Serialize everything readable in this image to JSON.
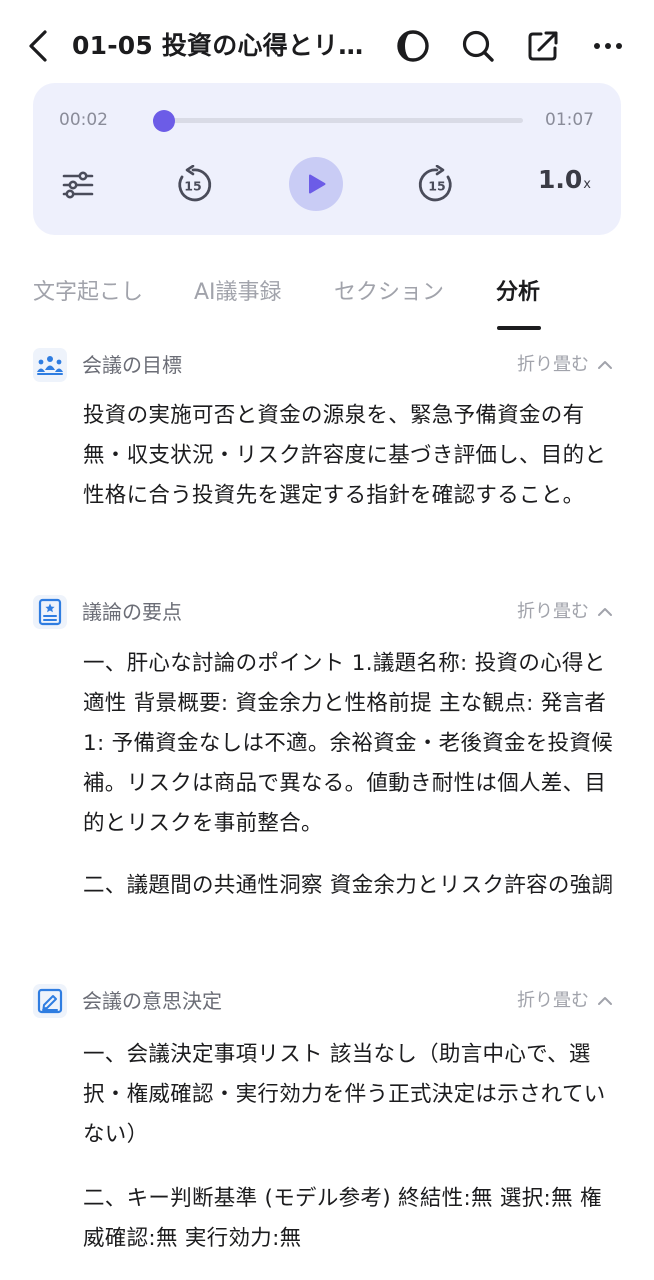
{
  "header": {
    "title": "01-05 投資の心得とリ…",
    "icons": [
      "back-icon",
      "theme-icon",
      "search-icon",
      "share-icon",
      "more-icon"
    ]
  },
  "player": {
    "current_time": "00:02",
    "total_time": "01:07",
    "progress": 0.03,
    "rewind_seconds": "15",
    "forward_seconds": "15",
    "speed_value": "1.0",
    "speed_unit": "x",
    "accent_color": "#6c5ce7"
  },
  "tabs": [
    {
      "label": "文字起こし",
      "active": false
    },
    {
      "label": "AI議事録",
      "active": false
    },
    {
      "label": "セクション",
      "active": false
    },
    {
      "label": "分析",
      "active": true
    }
  ],
  "sections": [
    {
      "icon": "meeting-people-icon",
      "title": "会議の目標",
      "collapse_label": "折り畳む",
      "paragraphs": [
        "投資の実施可否と資金の源泉を、緊急予備資金の有無・収支状況・リスク許容度に基づき評価し、目的と性格に合う投資先を選定する指針を確認すること。"
      ]
    },
    {
      "icon": "document-star-icon",
      "title": "議論の要点",
      "collapse_label": "折り畳む",
      "paragraphs": [
        "一、肝心な討論のポイント 1.議題名称: 投資の心得と適性 背景概要: 資金余力と性格前提 主な観点: 発言者1: 予備資金なしは不適。余裕資金・老後資金を投資候補。リスクは商品で異なる。値動き耐性は個人差、目的とリスクを事前整合。",
        "二、議題間の共通性洞察 資金余力とリスク許容の強調"
      ]
    },
    {
      "icon": "decision-pen-icon",
      "title": "会議の意思決定",
      "collapse_label": "折り畳む",
      "paragraphs": [
        "一、会議決定事項リスト 該当なし（助言中心で、選択・権威確認・実行効力を伴う正式決定は示されていない）",
        "二、キー判断基準 (モデル参考) 終結性:無 選択:無 権威確認:無 実行効力:無"
      ]
    }
  ]
}
